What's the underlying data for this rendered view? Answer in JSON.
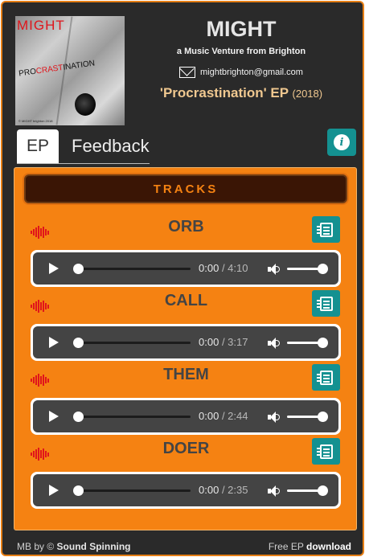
{
  "cover": {
    "brand": "MIGHT",
    "title_pre": "PRO",
    "title_red": "CRAST",
    "title_mid": "I",
    "title_post": "NATION",
    "footer": "© MIGHT brighton 2018"
  },
  "header": {
    "band_name": "MIGHT",
    "tagline": "a Music Venture from Brighton",
    "email": "mightbrighton@gmail.com",
    "ep_title": "'Procrastination' EP",
    "ep_year": "(2018)"
  },
  "tabs": [
    {
      "label": "EP",
      "active": true
    },
    {
      "label": "Feedback",
      "active": false
    }
  ],
  "info_button": {
    "icon": "info-icon",
    "glyph": "i"
  },
  "panel": {
    "header": "TRACKS",
    "tracks": [
      {
        "title": "ORB",
        "current": "0:00",
        "duration": "/ 4:10"
      },
      {
        "title": "CALL",
        "current": "0:00",
        "duration": "/ 3:17"
      },
      {
        "title": "THEM",
        "current": "0:00",
        "duration": "/ 2:44"
      },
      {
        "title": "DOER",
        "current": "0:00",
        "duration": "/ 2:35"
      }
    ],
    "volume_level": 1.0,
    "progress_level": 0.0
  },
  "footer": {
    "credit_prefix": "MB by ©",
    "credit_name": "Sound Spinning",
    "free_prefix": "Free EP",
    "download_label": "download"
  },
  "colors": {
    "accent_orange": "#f58212",
    "teal": "#149191",
    "dark_bg": "#2a2a2a",
    "waveform_red": "#e0151b"
  }
}
